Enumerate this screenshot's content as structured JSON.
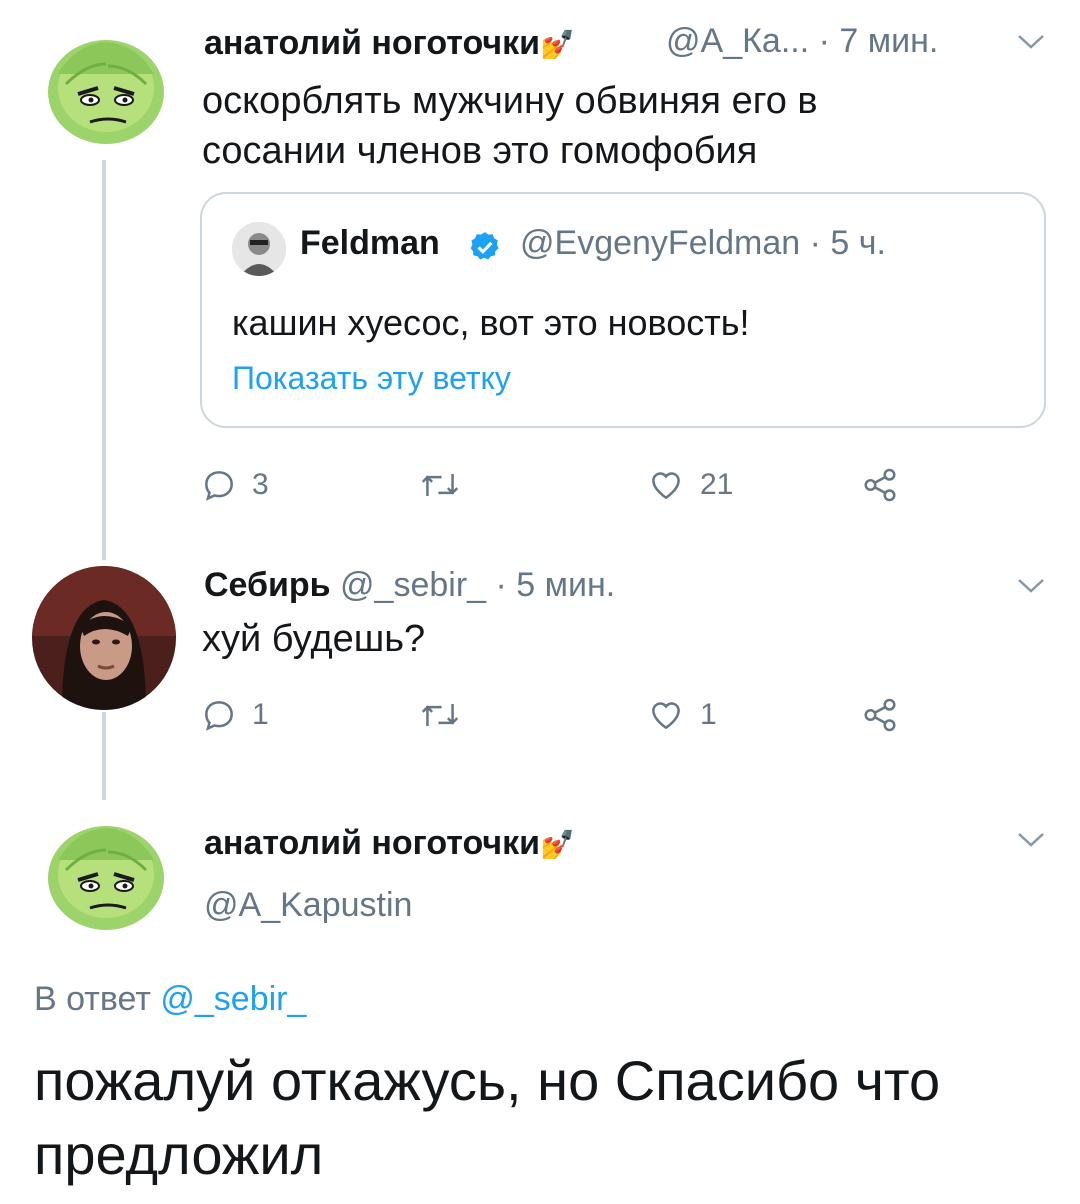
{
  "tweets": [
    {
      "author_name": "анатолий ноготочки",
      "author_emoji": "💅",
      "handle": "@А_Ка...",
      "time": "· 7 мин.",
      "text_line1": "оскорблять мужчину обвиняя его в",
      "text_line2": "сосании членов это гомофобия",
      "quote": {
        "author_name": "Feldman",
        "handle": "@EvgenyFeldman",
        "time": "· 5 ч.",
        "text": "кашин хуесос, вот это новость!",
        "show_thread": "Показать эту ветку"
      },
      "reply_count": "3",
      "like_count": "21"
    },
    {
      "author_name": "Себирь",
      "handle": "@_sebir_",
      "time": "· 5 мин.",
      "text": "хуй будешь?",
      "reply_count": "1",
      "like_count": "1"
    }
  ],
  "main_tweet": {
    "author_name": "анатолий ноготочки",
    "author_emoji": "💅",
    "handle": "@A_Kapustin",
    "reply_prefix": "В ответ",
    "reply_to": "@_sebir_",
    "text_line1": "пожалуй откажусь, но Спасибо что",
    "text_line2": "предложил"
  },
  "colors": {
    "text": "#14171a",
    "muted": "#657786",
    "link": "#1da1f2",
    "border": "#ccd6dd",
    "verified": "#1da1f2"
  },
  "icons": [
    "reply-icon",
    "retweet-icon",
    "like-icon",
    "share-icon",
    "chevron-down-icon",
    "verified-badge-icon",
    "nail-polish-emoji"
  ]
}
